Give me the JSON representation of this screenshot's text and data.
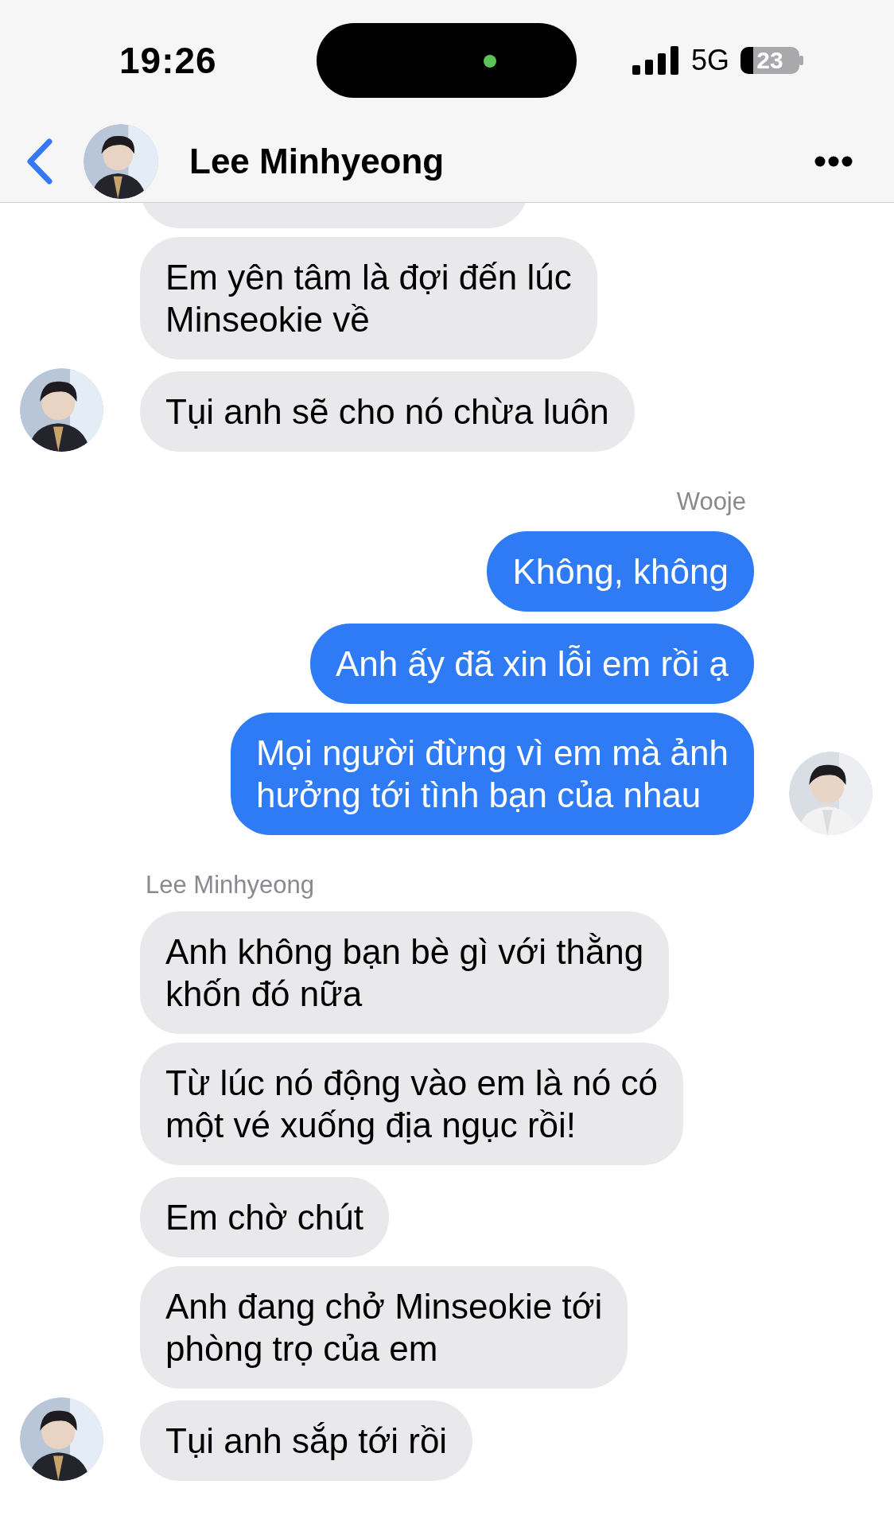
{
  "status_bar": {
    "time": "19:26",
    "network": "5G",
    "battery": "23"
  },
  "header": {
    "title": "Lee Minhyeong"
  },
  "groups": [
    {
      "kind": "incoming",
      "hidden_bubble": true,
      "bubbles": [
        "Em yên tâm là đợi đến lúc\nMinseokie về",
        "Tụi anh sẽ cho nó chừa luôn"
      ]
    },
    {
      "kind": "outgoing",
      "sender_label": "Wooje",
      "bubbles": [
        "Không, không",
        "Anh ấy đã xin lỗi em rồi ạ",
        "Mọi người đừng vì em mà ảnh\nhưởng tới tình bạn của nhau"
      ]
    },
    {
      "kind": "incoming",
      "sender_label": "Lee Minhyeong",
      "bubbles": [
        "Anh không bạn bè gì với thằng\nkhốn đó nữa",
        "Từ lúc nó động vào em là nó có\nmột vé xuống địa ngục rồi!",
        "Em chờ chút",
        "Anh đang chở Minseokie tới\nphòng trọ của em",
        "Tụi anh sắp tới rồi"
      ]
    }
  ]
}
